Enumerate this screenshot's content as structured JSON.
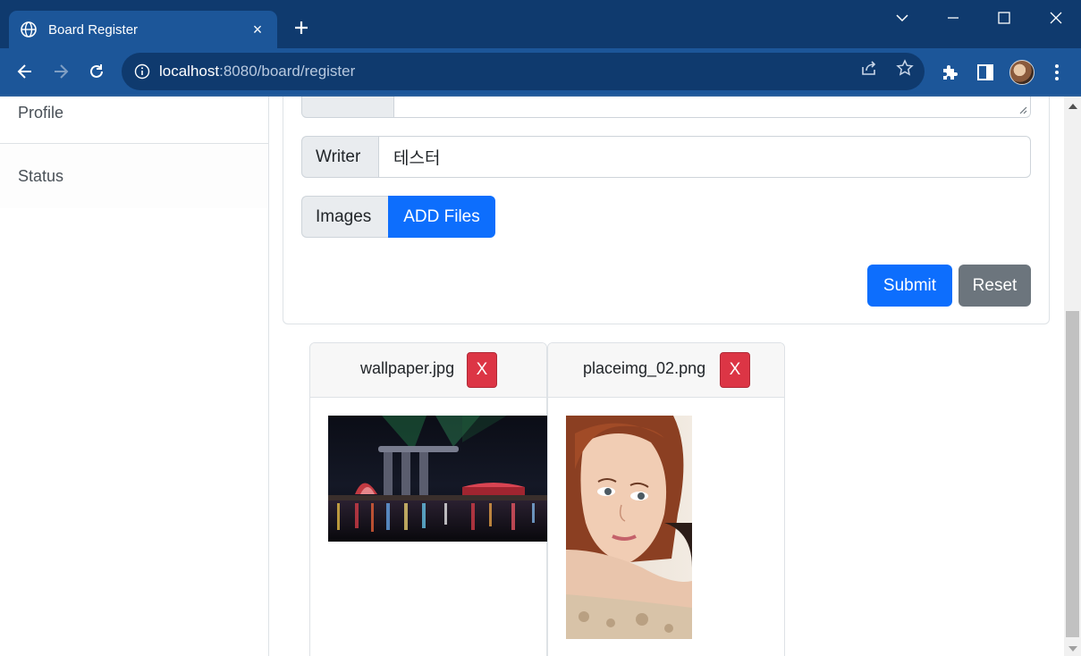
{
  "browser": {
    "tab_title": "Board Register",
    "tab_close": "×",
    "url_host": "localhost",
    "url_path": ":8080/board/register"
  },
  "sidebar": {
    "items": [
      {
        "label": "Profile"
      },
      {
        "label": "Status"
      }
    ]
  },
  "form": {
    "writer_label": "Writer",
    "writer_value": "테스터",
    "images_label": "Images",
    "add_files_label": "ADD Files",
    "submit_label": "Submit",
    "reset_label": "Reset"
  },
  "files": [
    {
      "name": "wallpaper.jpg",
      "remove_label": "X"
    },
    {
      "name": "placeimg_02.png",
      "remove_label": "X"
    }
  ],
  "colors": {
    "primary": "#0d6efd",
    "secondary": "#6c757d",
    "danger": "#dc3545",
    "chrome_frame": "#0f3a6e",
    "chrome_toolbar": "#1c5699"
  }
}
